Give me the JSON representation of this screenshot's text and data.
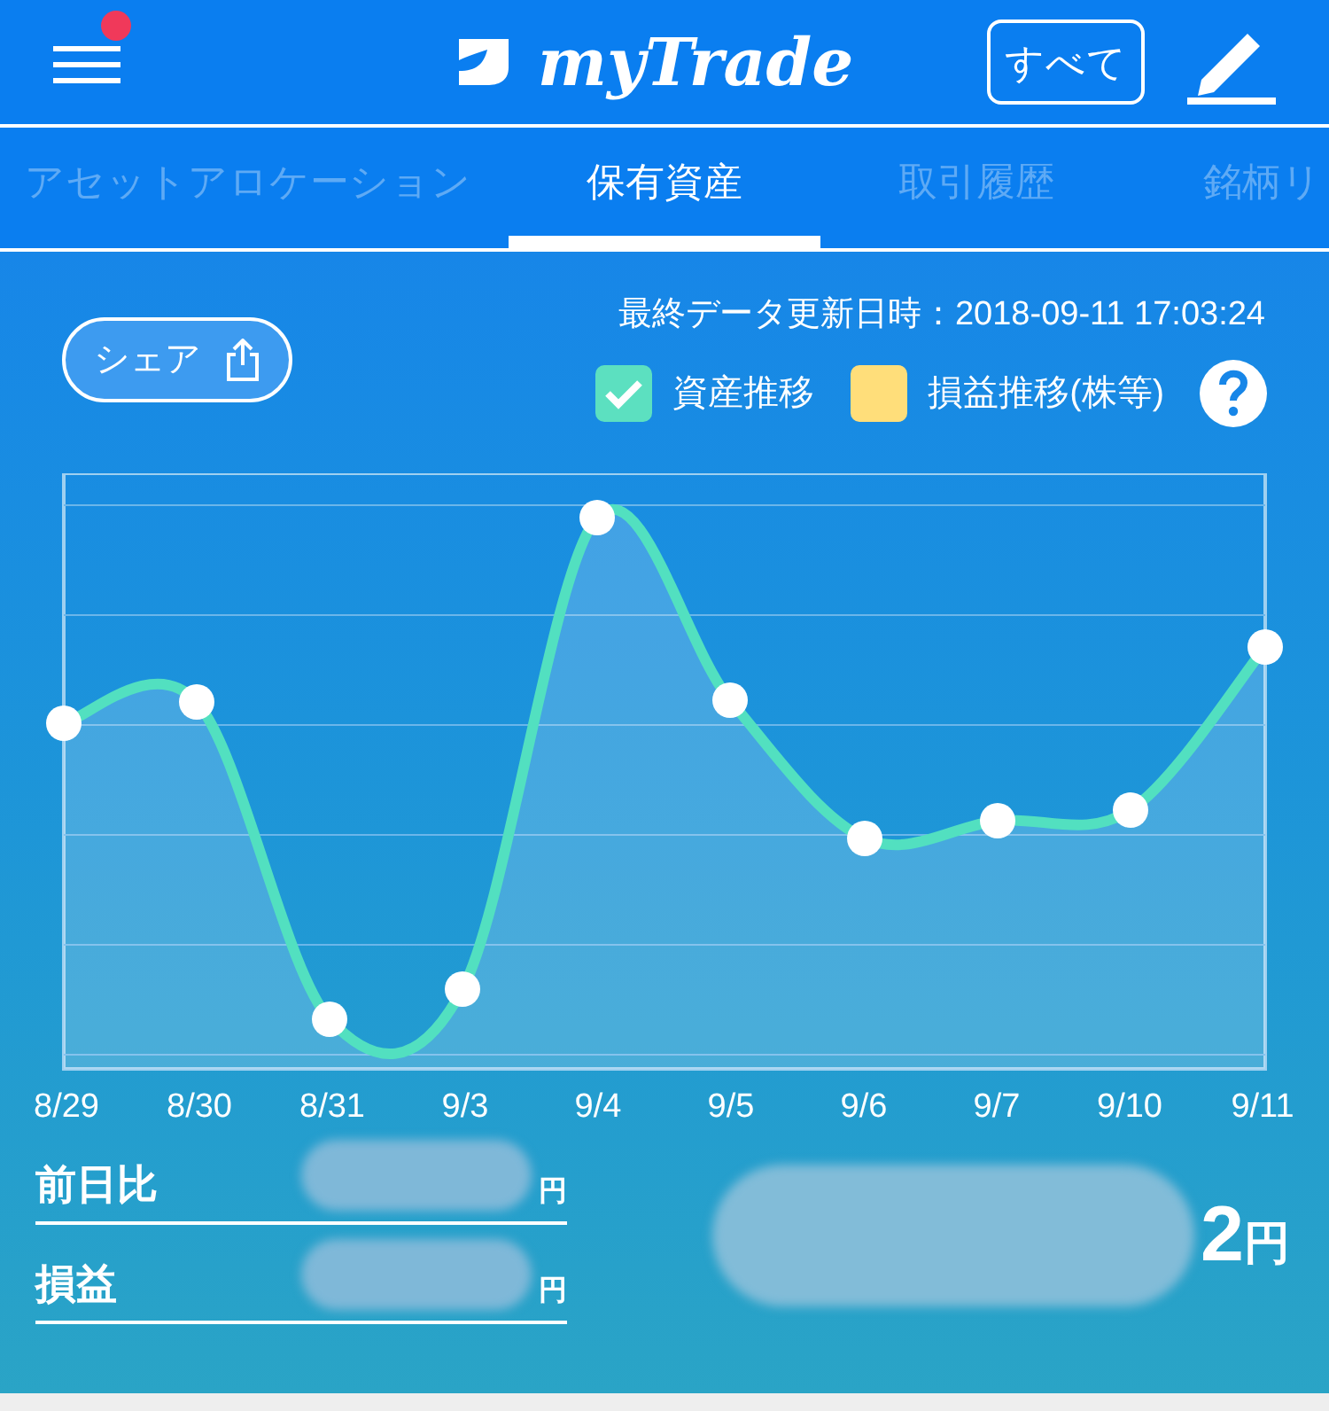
{
  "header": {
    "logo": "myTrade",
    "filter_button": "すべて",
    "notification": true
  },
  "tabs": [
    {
      "label": "アセットアロケーション",
      "selected": false
    },
    {
      "label": "保有資産",
      "selected": true
    },
    {
      "label": "取引履歴",
      "selected": false
    },
    {
      "label": "銘柄リ",
      "selected": false
    }
  ],
  "share_button": "シェア",
  "updated": "最終データ更新日時：2018-09-11 17:03:24",
  "legend": [
    {
      "label": "資産推移",
      "checked": true,
      "color": "#5ce0c0"
    },
    {
      "label": "損益推移(株等)",
      "checked": false,
      "color": "#ffde7a"
    }
  ],
  "chart": {
    "x_labels": [
      "8/29",
      "8/30",
      "8/31",
      "9/3",
      "9/4",
      "9/5",
      "9/6",
      "9/7",
      "9/10",
      "9/11"
    ]
  },
  "summary": [
    {
      "label": "前日比",
      "unit": "円"
    },
    {
      "label": "損益",
      "unit": "円"
    }
  ],
  "total": {
    "digit": "2",
    "unit": "円"
  }
}
